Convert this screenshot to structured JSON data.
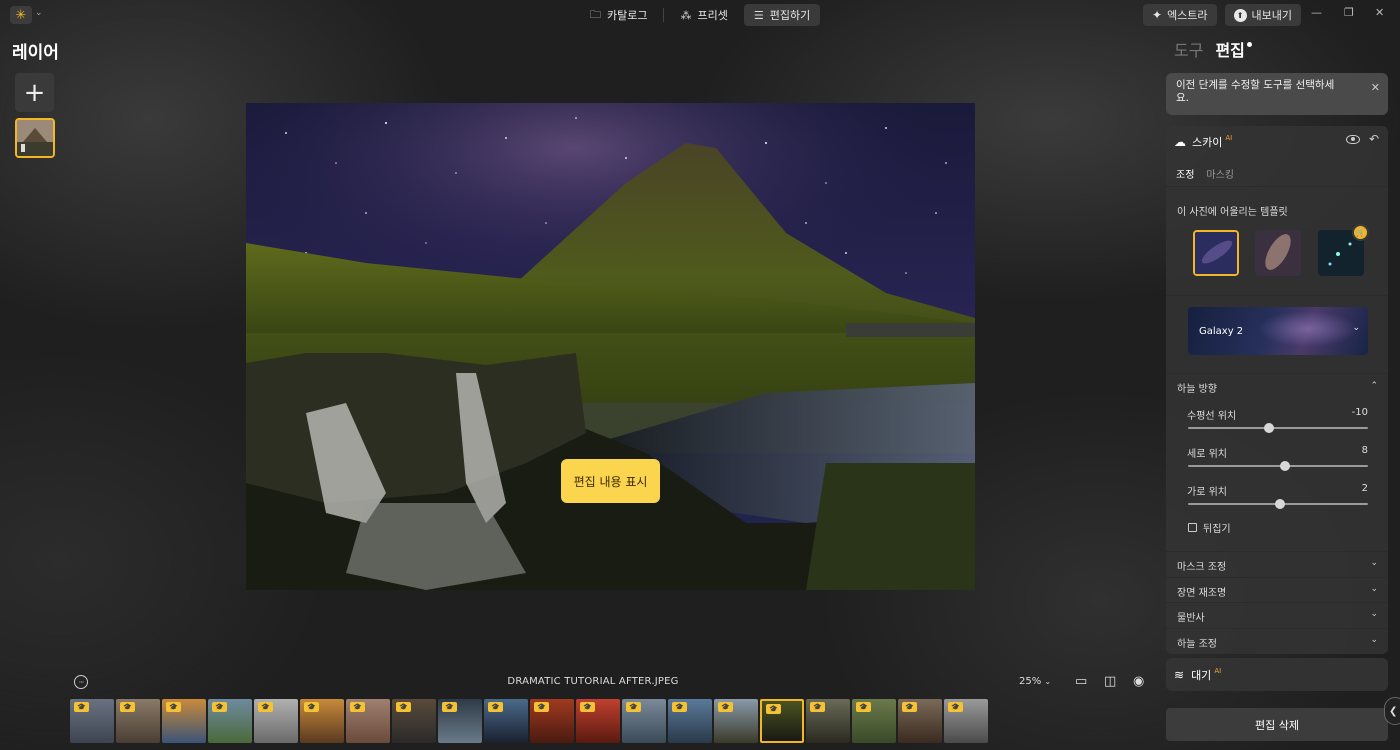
{
  "topbar": {
    "logo_icon": "sun-logo-icon",
    "nav": [
      {
        "label": "카탈로그",
        "icon": "folder-icon",
        "active": false
      },
      {
        "label": "프리셋",
        "icon": "magic-wand-icon",
        "active": false
      },
      {
        "label": "편집하기",
        "icon": "sliders-icon",
        "active": true
      }
    ],
    "extras_label": "엑스트라",
    "export_label": "내보내기"
  },
  "left_panel": {
    "title": "레이어",
    "add_icon": "plus-icon"
  },
  "canvas": {
    "show_edits_label": "편집 내용 표시"
  },
  "bottom_bar": {
    "filename": "DRAMATIC TUTORIAL AFTER.JPEG",
    "zoom": "25%",
    "filmstrip_count": 20,
    "selected_index": 15
  },
  "right_panel": {
    "tabs": [
      {
        "label": "도구",
        "active": false
      },
      {
        "label": "편집",
        "active": true
      }
    ],
    "hint": "이전 단계를 수정할 도구를 선택하세요.",
    "tool": {
      "name": "스카이",
      "ai_mark": "AI",
      "sub_tabs": [
        {
          "label": "조정",
          "active": true
        },
        {
          "label": "마스킹",
          "active": false
        }
      ],
      "templates_label": "이 사진에 어울리는 템플릿",
      "selected_sky": "Galaxy 2",
      "orientation_title": "하늘 방향",
      "sliders": [
        {
          "label": "수평선 위치",
          "value": "-10",
          "fraction": 0.45
        },
        {
          "label": "세로 위치",
          "value": "8",
          "fraction": 0.54
        },
        {
          "label": "가로 위치",
          "value": "2",
          "fraction": 0.51
        }
      ],
      "flip_label": "뒤집기",
      "sections": [
        "마스크 조정",
        "장면 재조명",
        "물반사",
        "하늘 조정"
      ]
    },
    "wait_label": "대기",
    "wait_ai_mark": "AI",
    "delete_label": "편집 삭제"
  },
  "colors": {
    "accent": "#f3b624",
    "show_edits_bg": "#fcd54e"
  }
}
